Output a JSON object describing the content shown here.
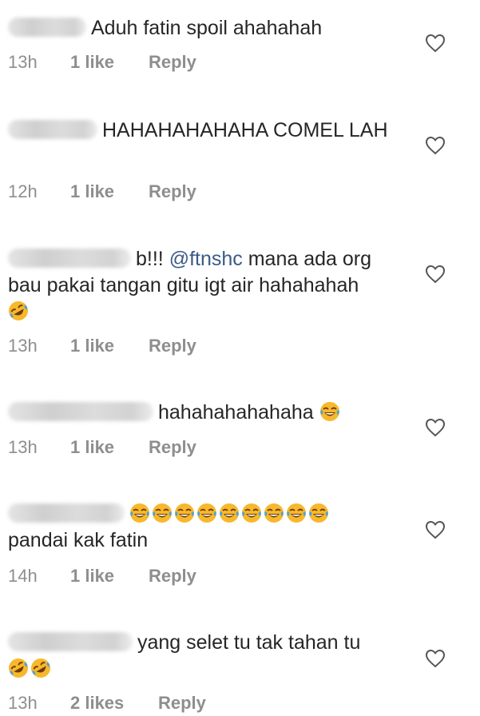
{
  "comments": [
    {
      "text": "Aduh fatin spoil ahahahah",
      "time": "13h",
      "likes": "1 like",
      "reply": "Reply"
    },
    {
      "text": "HAHAHAHAHAHA COMEL LAH",
      "time": "12h",
      "likes": "1 like",
      "reply": "Reply"
    },
    {
      "prefix": "b!!!",
      "mention": "@ftnshc",
      "text": "mana ada org bau pakai tangan gitu igt air hahahahah",
      "time": "13h",
      "likes": "1 like",
      "reply": "Reply",
      "emoji": "rolling-on-floor-laughing"
    },
    {
      "text": "hahahahahahaha",
      "time": "13h",
      "likes": "1 like",
      "reply": "Reply",
      "emoji": "tears-of-joy"
    },
    {
      "text": "pandai kak fatin",
      "time": "14h",
      "likes": "1 like",
      "reply": "Reply",
      "emoji": "tears-of-joy"
    },
    {
      "text": "yang selet tu tak tahan tu",
      "time": "13h",
      "likes": "2 likes",
      "reply": "Reply",
      "emoji": "rolling-on-floor-laughing"
    }
  ],
  "icons": {
    "like": "heart-outline-icon"
  },
  "colors": {
    "text": "#262626",
    "meta": "#8e8e8e",
    "mention": "#3a5a86",
    "emoji": "#f7b82c"
  }
}
